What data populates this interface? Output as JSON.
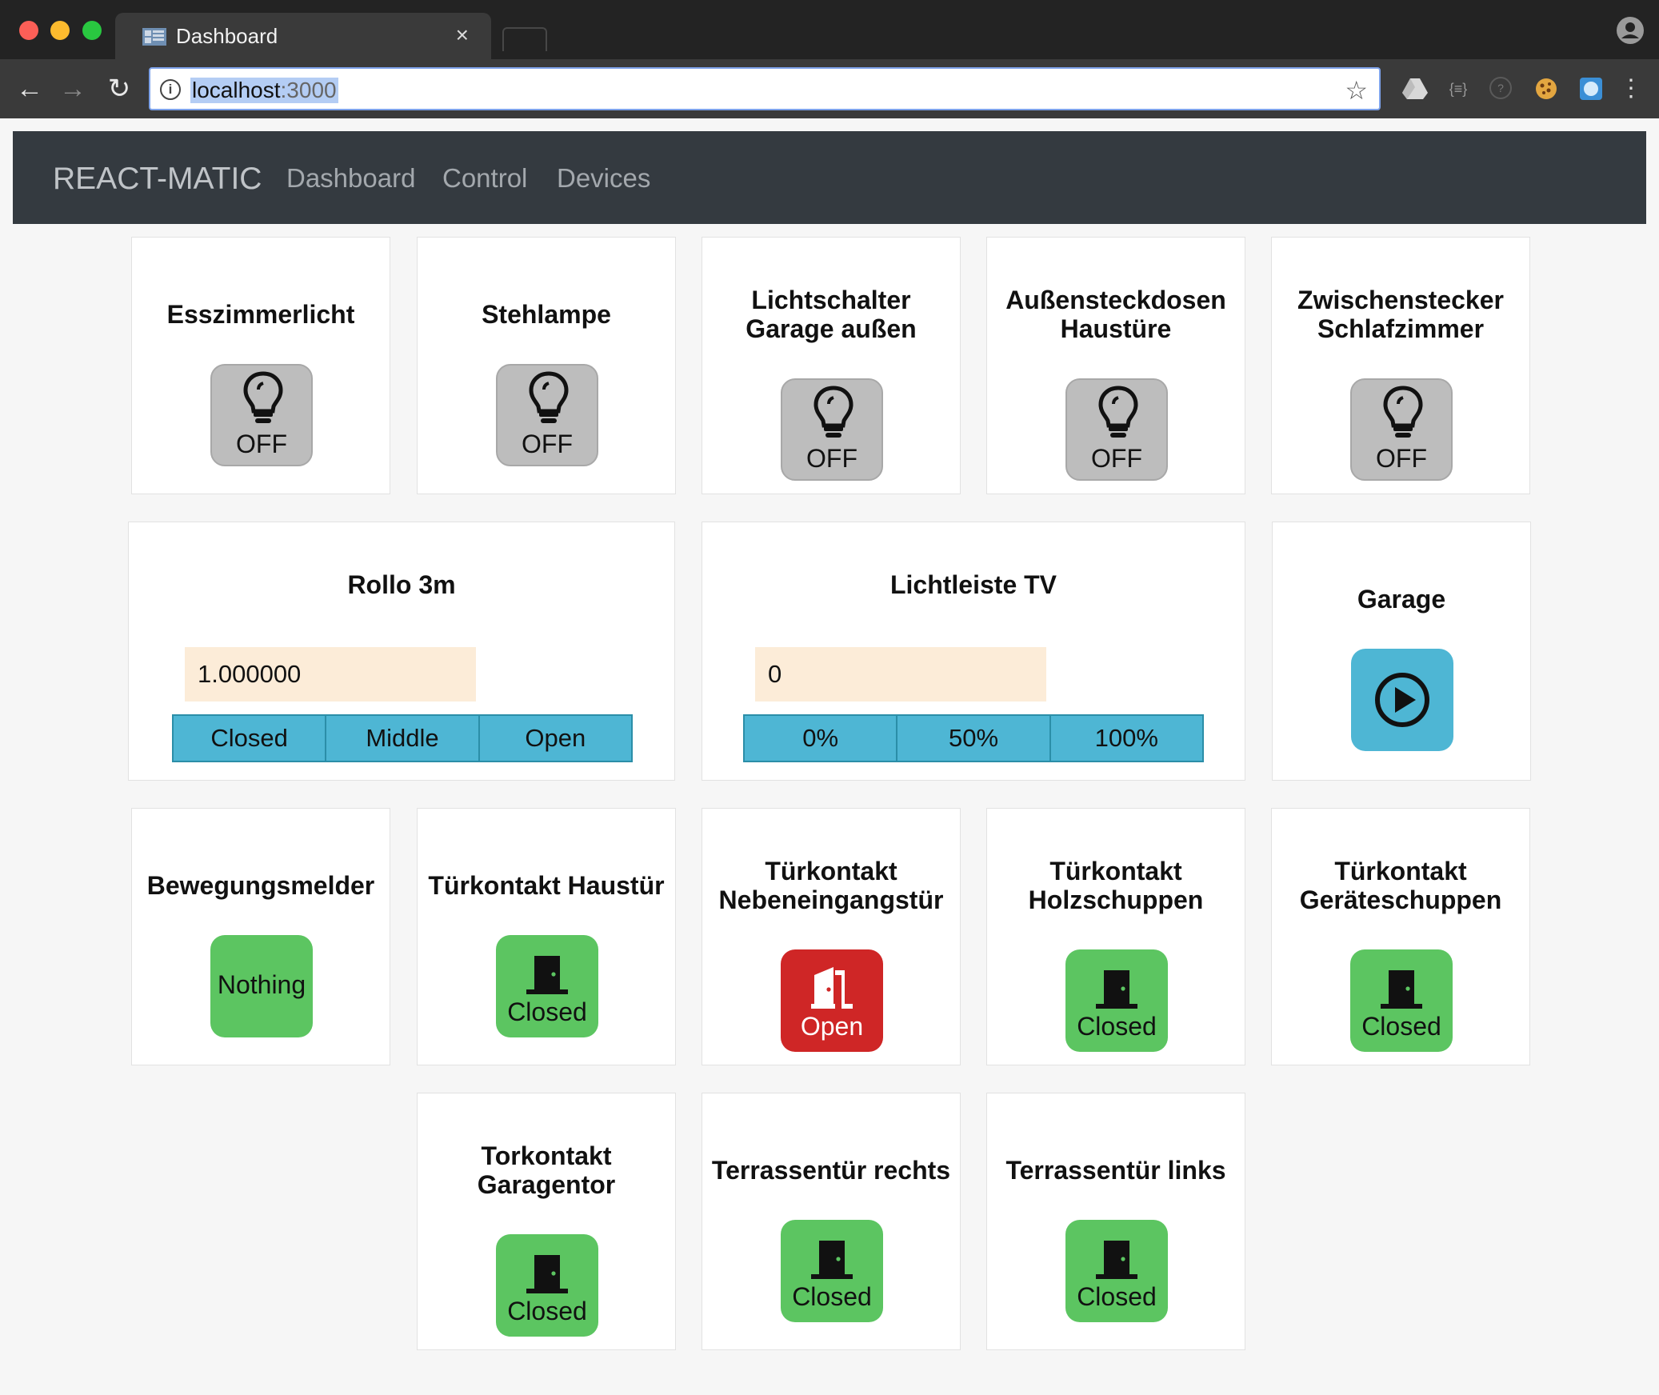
{
  "browser": {
    "tab_title": "Dashboard",
    "tab_close": "×",
    "url_host": "localhost",
    "url_port": ":3000"
  },
  "navbar": {
    "brand": "REACT-MATIC",
    "links": [
      "Dashboard",
      "Control",
      "Devices"
    ]
  },
  "switches": [
    {
      "name": "Esszimmerlicht",
      "state": "OFF"
    },
    {
      "name": "Stehlampe",
      "state": "OFF"
    },
    {
      "name": "Lichtschalter Garage außen",
      "state": "OFF"
    },
    {
      "name": "Außensteckdosen Haustüre",
      "state": "OFF"
    },
    {
      "name": "Zwischenstecker Schlafzimmer",
      "state": "OFF"
    }
  ],
  "blind": {
    "name": "Rollo 3m",
    "value": "1.000000",
    "buttons": [
      "Closed",
      "Middle",
      "Open"
    ]
  },
  "dimmer": {
    "name": "Lichtleiste TV",
    "value": "0",
    "buttons": [
      "0%",
      "50%",
      "100%"
    ]
  },
  "garage": {
    "name": "Garage"
  },
  "sensors": [
    {
      "name": "Bewegungsmelder",
      "state": "Nothing"
    },
    {
      "name": "Türkontakt Haustür",
      "state": "Closed"
    },
    {
      "name": "Türkontakt Nebeneingangstür",
      "state": "Open"
    },
    {
      "name": "Türkontakt Holzschuppen",
      "state": "Closed"
    },
    {
      "name": "Türkontakt Geräteschuppen",
      "state": "Closed"
    },
    {
      "name": "Torkontakt Garagentor",
      "state": "Closed"
    },
    {
      "name": "Terrassentür rechts",
      "state": "Closed"
    },
    {
      "name": "Terrassentür links",
      "state": "Closed"
    }
  ],
  "colors": {
    "off_tile": "#bdbdbd",
    "closed_tile": "#5cc561",
    "open_tile": "#cf2626",
    "action_tile": "#4eb6d4",
    "navbar": "#343a40"
  }
}
